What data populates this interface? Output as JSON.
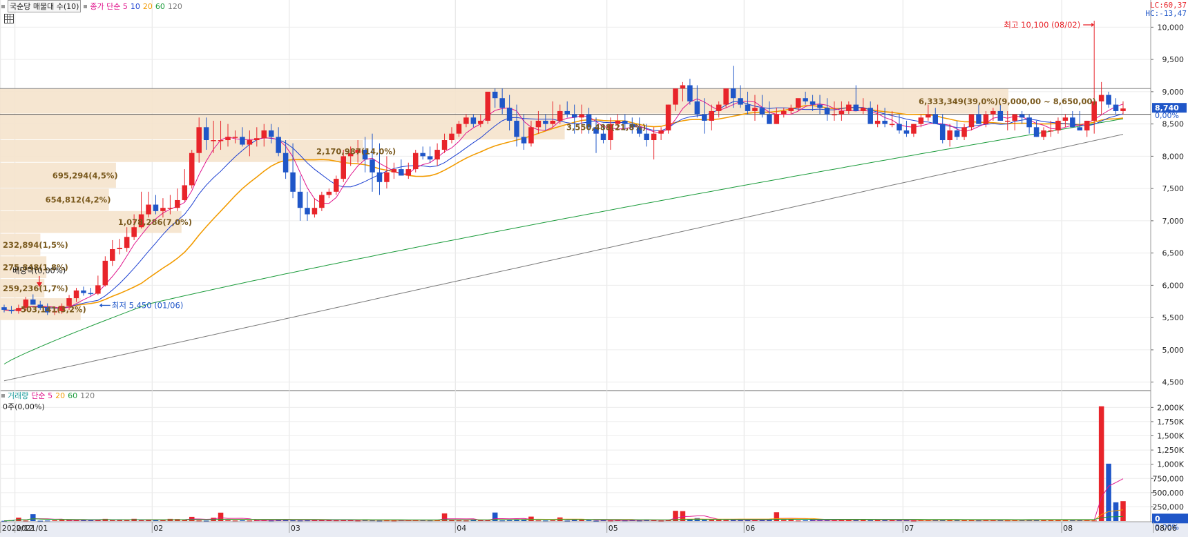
{
  "title_bar": {
    "stock_name": "국순당 매물대 수(10)",
    "ma_label": "종가 단순 5",
    "ma_periods": [
      "10",
      "20",
      "60",
      "120"
    ],
    "ma_colors": [
      "#e0148c",
      "#1b3fd1",
      "#f29b00",
      "#1a9b3a",
      "#7a7a7a"
    ]
  },
  "corner": {
    "lc": "LC:60,37",
    "hc": "HC:-13,47"
  },
  "volume_bar": {
    "label": "거래량",
    "ma_label": "단순 5",
    "ma_periods": [
      "20",
      "60",
      "120"
    ],
    "value": "0주(0,00%)"
  },
  "chart_data": {
    "type": "candlestick",
    "x": [
      "2020-12-29",
      "2020-12-30",
      "2021-01-04",
      "2021-01-05",
      "2021-01-06",
      "2021-01-07",
      "2021-01-08",
      "2021-01-11",
      "2021-01-12",
      "2021-01-13",
      "2021-01-14",
      "2021-01-15",
      "2021-01-18",
      "2021-01-19",
      "2021-01-20",
      "2021-01-21",
      "2021-01-22",
      "2021-01-25",
      "2021-01-26",
      "2021-01-27",
      "2021-01-28",
      "2021-01-29",
      "2021-02-01",
      "2021-02-02",
      "2021-02-03",
      "2021-02-04",
      "2021-02-05",
      "2021-02-08",
      "2021-02-09",
      "2021-02-10",
      "2021-02-15",
      "2021-02-16",
      "2021-02-17",
      "2021-02-18",
      "2021-02-19",
      "2021-02-22",
      "2021-02-23",
      "2021-02-24",
      "2021-02-25",
      "2021-02-26",
      "2021-03-02",
      "2021-03-03",
      "2021-03-04",
      "2021-03-05",
      "2021-03-08",
      "2021-03-09",
      "2021-03-10",
      "2021-03-11",
      "2021-03-12",
      "2021-03-15",
      "2021-03-16",
      "2021-03-17",
      "2021-03-18",
      "2021-03-19",
      "2021-03-22",
      "2021-03-23",
      "2021-03-24",
      "2021-03-25",
      "2021-03-26",
      "2021-03-29",
      "2021-03-30",
      "2021-03-31",
      "2021-04-01",
      "2021-04-02",
      "2021-04-05",
      "2021-04-06",
      "2021-04-07",
      "2021-04-08",
      "2021-04-09",
      "2021-04-12",
      "2021-04-13",
      "2021-04-14",
      "2021-04-15",
      "2021-04-16",
      "2021-04-19",
      "2021-04-20",
      "2021-04-21",
      "2021-04-22",
      "2021-04-23",
      "2021-04-26",
      "2021-04-27",
      "2021-04-28",
      "2021-04-29",
      "2021-04-30",
      "2021-05-03",
      "2021-05-04",
      "2021-05-06",
      "2021-05-07",
      "2021-05-10",
      "2021-05-11",
      "2021-05-12",
      "2021-05-13",
      "2021-05-14",
      "2021-05-17",
      "2021-05-18",
      "2021-05-20",
      "2021-05-21",
      "2021-05-24",
      "2021-05-25",
      "2021-05-26",
      "2021-05-27",
      "2021-05-28",
      "2021-05-31",
      "2021-06-01",
      "2021-06-02",
      "2021-06-03",
      "2021-06-04",
      "2021-06-07",
      "2021-06-08",
      "2021-06-09",
      "2021-06-10",
      "2021-06-11",
      "2021-06-14",
      "2021-06-15",
      "2021-06-16",
      "2021-06-17",
      "2021-06-18",
      "2021-06-21",
      "2021-06-22",
      "2021-06-23",
      "2021-06-24",
      "2021-06-25",
      "2021-06-28",
      "2021-06-29",
      "2021-06-30",
      "2021-07-01",
      "2021-07-02",
      "2021-07-05",
      "2021-07-06",
      "2021-07-07",
      "2021-07-08",
      "2021-07-09",
      "2021-07-12",
      "2021-07-13",
      "2021-07-14",
      "2021-07-15",
      "2021-07-16",
      "2021-07-19",
      "2021-07-20",
      "2021-07-21",
      "2021-07-22",
      "2021-07-23",
      "2021-07-26",
      "2021-07-27",
      "2021-07-28",
      "2021-07-29",
      "2021-07-30",
      "2021-08-02",
      "2021-08-03",
      "2021-08-04",
      "2021-08-05",
      "2021-08-06"
    ],
    "open": [
      5660,
      5620,
      5600,
      5650,
      5780,
      5700,
      5650,
      5580,
      5600,
      5680,
      5800,
      5920,
      5880,
      5870,
      6000,
      6380,
      6560,
      6580,
      6750,
      6900,
      7100,
      7250,
      7150,
      7200,
      7200,
      7320,
      7550,
      8050,
      8450,
      8250,
      8250,
      8250,
      8300,
      8300,
      8180,
      8250,
      8280,
      8400,
      8300,
      8050,
      7750,
      7450,
      7200,
      7100,
      7200,
      7400,
      7450,
      7650,
      8000,
      8050,
      8100,
      7950,
      7750,
      7600,
      7750,
      7800,
      7700,
      7800,
      8050,
      8000,
      7950,
      8100,
      8250,
      8350,
      8500,
      8600,
      8500,
      8550,
      9000,
      8900,
      8750,
      8550,
      8300,
      8200,
      8450,
      8550,
      8500,
      8550,
      8700,
      8650,
      8600,
      8650,
      8450,
      8350,
      8250,
      8500,
      8550,
      8500,
      8450,
      8350,
      8250,
      8350,
      8400,
      8800,
      9050,
      9100,
      8850,
      8650,
      8550,
      8700,
      8800,
      9050,
      8900,
      8800,
      8700,
      8750,
      8650,
      8500,
      8650,
      8700,
      8750,
      8900,
      8850,
      8800,
      8750,
      8650,
      8650,
      8700,
      8800,
      8700,
      8750,
      8500,
      8550,
      8500,
      8500,
      8400,
      8350,
      8500,
      8600,
      8650,
      8500,
      8250,
      8400,
      8300,
      8450,
      8650,
      8500,
      8650,
      8700,
      8550,
      8550,
      8650,
      8600,
      8450,
      8300,
      8400,
      8400,
      8550,
      8600,
      8450,
      8400,
      8550,
      8850,
      8950,
      8800,
      8700
    ],
    "high": [
      5700,
      5680,
      5700,
      5820,
      5860,
      5760,
      5720,
      5640,
      5720,
      5850,
      5960,
      5980,
      5960,
      6150,
      6450,
      6700,
      6720,
      6900,
      7100,
      7450,
      7450,
      7400,
      7350,
      7400,
      7500,
      7800,
      8100,
      8600,
      8600,
      8550,
      8550,
      8500,
      8400,
      8450,
      8400,
      8450,
      8500,
      8500,
      8450,
      8250,
      8200,
      7700,
      7450,
      7350,
      7450,
      7500,
      7700,
      8100,
      8150,
      8250,
      8300,
      8350,
      8200,
      8000,
      7900,
      7950,
      7900,
      8100,
      8150,
      8150,
      8200,
      8350,
      8450,
      8550,
      8650,
      8650,
      8650,
      8950,
      9050,
      9050,
      8950,
      8800,
      8650,
      8550,
      8700,
      8650,
      8850,
      8800,
      8850,
      8800,
      8800,
      8750,
      8600,
      8500,
      8600,
      8650,
      8650,
      8600,
      8600,
      8500,
      8450,
      8450,
      8800,
      9000,
      9150,
      9200,
      9100,
      8900,
      8800,
      8850,
      9000,
      9400,
      9100,
      9000,
      8950,
      8950,
      8850,
      8750,
      8750,
      8800,
      8800,
      9000,
      8950,
      8950,
      8900,
      8850,
      8850,
      8850,
      9100,
      8900,
      8850,
      8800,
      8750,
      8700,
      8650,
      8550,
      8500,
      8650,
      8800,
      8750,
      8650,
      8500,
      8550,
      8500,
      8650,
      8800,
      8700,
      8750,
      8800,
      8700,
      8650,
      8700,
      8650,
      8550,
      8450,
      8550,
      8600,
      8650,
      8700,
      8700,
      8550,
      10100,
      9150,
      9000,
      8900,
      8850
    ],
    "low": [
      5580,
      5560,
      5560,
      5600,
      5700,
      5620,
      5540,
      5540,
      5560,
      5620,
      5740,
      5840,
      5840,
      5850,
      5980,
      6300,
      6480,
      6520,
      6700,
      6880,
      7050,
      7100,
      7050,
      7100,
      7150,
      7300,
      7500,
      7900,
      8100,
      8050,
      8100,
      8150,
      8200,
      8150,
      8000,
      8150,
      8150,
      8200,
      8000,
      7650,
      7350,
      7000,
      7000,
      7050,
      7150,
      7350,
      7400,
      7600,
      7850,
      7900,
      7750,
      7450,
      7400,
      7500,
      7650,
      7700,
      7650,
      7750,
      7950,
      7900,
      7850,
      8050,
      8200,
      8300,
      8450,
      8450,
      8450,
      8500,
      8750,
      8650,
      8400,
      8150,
      8100,
      8150,
      8350,
      8400,
      8450,
      8500,
      8600,
      8350,
      8350,
      8350,
      8050,
      8200,
      8100,
      8400,
      8400,
      8350,
      8300,
      8150,
      7950,
      8250,
      8350,
      8700,
      8850,
      8800,
      8600,
      8350,
      8400,
      8600,
      8750,
      8750,
      8750,
      8650,
      8550,
      8600,
      8500,
      8500,
      8600,
      8650,
      8700,
      8800,
      8700,
      8650,
      8550,
      8550,
      8550,
      8650,
      8700,
      8650,
      8550,
      8450,
      8450,
      8450,
      8350,
      8300,
      8300,
      8450,
      8550,
      8500,
      8200,
      8150,
      8250,
      8250,
      8400,
      8500,
      8450,
      8550,
      8550,
      8400,
      8400,
      8500,
      8350,
      8300,
      8250,
      8300,
      8350,
      8450,
      8450,
      8400,
      8300,
      8350,
      8650,
      8750,
      8650,
      8650
    ],
    "close": [
      5620,
      5600,
      5650,
      5780,
      5700,
      5650,
      5580,
      5600,
      5680,
      5800,
      5920,
      5880,
      5870,
      6000,
      6380,
      6560,
      6580,
      6750,
      6900,
      7100,
      7250,
      7150,
      7200,
      7200,
      7320,
      7550,
      8050,
      8450,
      8250,
      8250,
      8250,
      8300,
      8300,
      8180,
      8250,
      8280,
      8400,
      8300,
      8050,
      7750,
      7450,
      7200,
      7100,
      7200,
      7400,
      7450,
      7650,
      8000,
      8050,
      8100,
      7950,
      7750,
      7600,
      7750,
      7800,
      7700,
      7800,
      8050,
      8000,
      7950,
      8100,
      8250,
      8350,
      8500,
      8600,
      8500,
      8550,
      9000,
      8900,
      8750,
      8550,
      8300,
      8200,
      8450,
      8550,
      8500,
      8550,
      8700,
      8650,
      8600,
      8650,
      8450,
      8350,
      8250,
      8500,
      8550,
      8500,
      8450,
      8350,
      8250,
      8350,
      8400,
      8800,
      9050,
      9100,
      8850,
      8650,
      8550,
      8700,
      8800,
      9050,
      8900,
      8800,
      8700,
      8750,
      8650,
      8500,
      8650,
      8700,
      8750,
      8900,
      8850,
      8800,
      8750,
      8650,
      8650,
      8700,
      8800,
      8700,
      8750,
      8500,
      8550,
      8500,
      8500,
      8400,
      8350,
      8500,
      8600,
      8650,
      8500,
      8250,
      8400,
      8300,
      8450,
      8650,
      8500,
      8650,
      8700,
      8550,
      8550,
      8650,
      8600,
      8450,
      8300,
      8400,
      8400,
      8550,
      8600,
      8450,
      8400,
      8550,
      8850,
      8950,
      8800,
      8700,
      8740
    ],
    "volume": [
      4,
      14,
      60,
      8,
      120,
      6,
      9,
      13,
      19,
      15,
      17,
      22,
      14,
      19,
      38,
      14,
      16,
      15,
      39,
      12,
      20,
      13,
      12,
      38,
      35,
      26,
      74,
      9,
      7,
      58,
      148,
      14,
      9,
      12,
      9,
      12,
      17,
      9,
      24,
      30,
      11,
      9,
      11,
      19,
      20,
      14,
      11,
      18,
      12,
      9,
      30,
      11,
      8,
      11,
      9,
      12,
      15,
      16,
      14,
      11,
      18,
      135,
      17,
      11,
      9,
      26,
      13,
      12,
      150,
      10,
      14,
      29,
      20,
      78,
      11,
      9,
      12,
      64,
      7,
      19,
      35,
      14,
      6,
      13,
      9,
      16,
      10,
      14,
      9,
      27,
      14,
      8,
      18,
      180,
      175,
      30,
      52,
      20,
      20,
      21,
      16,
      19,
      22,
      14,
      16,
      20,
      24,
      155,
      19,
      22,
      10,
      13,
      16,
      13,
      18,
      13,
      25,
      20,
      17,
      26,
      13,
      21,
      14,
      14,
      19,
      12,
      8,
      14,
      16,
      30,
      24,
      18,
      15,
      13,
      15,
      11,
      22,
      12,
      15,
      11,
      13,
      19,
      22,
      23,
      20,
      14,
      19,
      17,
      12,
      14,
      18,
      10,
      2020,
      1010,
      330,
      350
    ],
    "y_axis_ticks": [
      "10,000",
      "9,500",
      "9,000",
      "8,500",
      "8,000",
      "7,500",
      "7,000",
      "6,500",
      "6,000",
      "5,500",
      "5,000",
      "4,500"
    ],
    "volume_axis_ticks": [
      "2,000K",
      "1,750K",
      "1,500K",
      "1,250K",
      "1,000K",
      "750,000",
      "500,000",
      "250,000"
    ],
    "x_axis_labels": [
      "2020/12",
      "2021/01",
      "02",
      "03",
      "04",
      "05",
      "06",
      "07",
      "08",
      "08/06"
    ],
    "current_price": "8,740",
    "change": "0,00%",
    "volume_now": "0",
    "volume_change": "0,00%",
    "ylim": [
      4400,
      10250
    ],
    "volume_ylim": [
      0,
      2150
    ],
    "volume_profile": [
      {
        "price_low": 8650,
        "price_high": 9050,
        "label": "6,333,349(39,0%)(9,000,00 ~ 8,650,00)",
        "ratio": 1.0
      },
      {
        "price_low": 8250,
        "price_high": 8650,
        "label": "3,550,488(21,8%)",
        "ratio": 0.56
      },
      {
        "price_low": 7900,
        "price_high": 8250,
        "label": "2,170,987(14,0%)",
        "ratio": 0.36
      },
      {
        "price_low": 7500,
        "price_high": 7900,
        "label": "695,294(4,5%)",
        "ratio": 0.115
      },
      {
        "price_low": 7150,
        "price_high": 7500,
        "label": "654,812(4,2%)",
        "ratio": 0.108
      },
      {
        "price_low": 6800,
        "price_high": 7150,
        "label": "1,078,286(7,0%)",
        "ratio": 0.18
      },
      {
        "price_low": 6450,
        "price_high": 6800,
        "label": "232,894(1,5%)",
        "ratio": 0.04
      },
      {
        "price_low": 6100,
        "price_high": 6450,
        "label": "275,848(1,8%)",
        "ratio": 0.046
      },
      {
        "price_low": 5800,
        "price_high": 6100,
        "label": "259,236(1,7%)",
        "ratio": 0.044
      },
      {
        "price_low": 5450,
        "price_high": 5800,
        "label": "503,141(3,2%)",
        "ratio": 0.08
      }
    ],
    "annotations": {
      "high": "최고 10,100 (08/02)",
      "low": "최저 5,450 (01/06)",
      "dividend": "배당락(0,00%)"
    },
    "colors": {
      "up": "#e8242a",
      "down": "#1f56c8",
      "profile": "#f5e3cc",
      "profile_text": "#7a5a1e"
    }
  }
}
